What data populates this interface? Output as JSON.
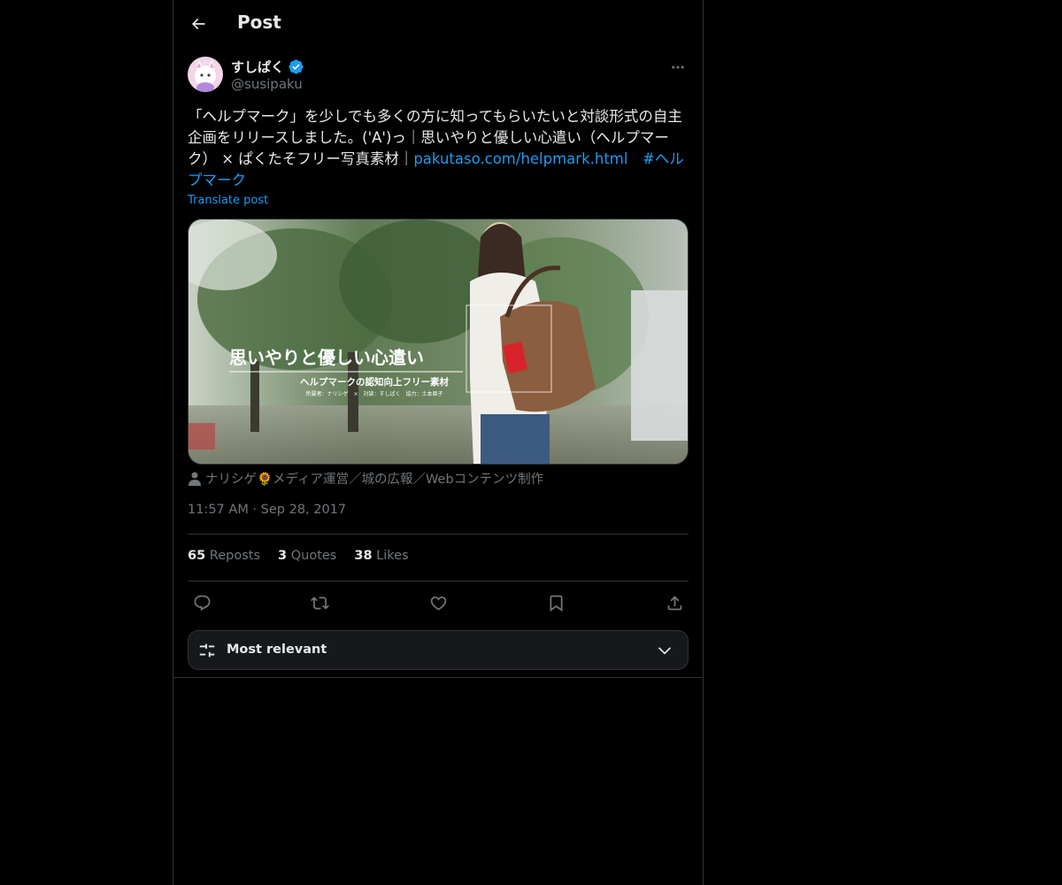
{
  "header": {
    "title": "Post"
  },
  "author": {
    "display_name": "すしぱく",
    "handle": "@susipaku",
    "verified": true
  },
  "tweet": {
    "text_before": "「ヘルプマーク」を少しでも多くの方に知ってもらいたいと対談形式の自主企画をリリースしました。('A')っ｜思いやりと優しい心遣い（ヘルプマーク） × ぱくたそフリー写真素材｜",
    "link": "pakutaso.com/helpmark.html",
    "hashtag": "#ヘルプマーク",
    "translate": "Translate post"
  },
  "media": {
    "title": "思いやりと優しい心遣い",
    "subtitle": "ヘルプマークの認知向上フリー素材",
    "credits": "所属者：ナリシゲ　×　対談：すしぱく　協力：土本亜子"
  },
  "attribution": "ナリシゲ🌻メディア運営／城の広報／Webコンテンツ制作",
  "timestamp": "11:57 AM · Sep 28, 2017",
  "stats": {
    "reposts_count": "65",
    "reposts_label": "Reposts",
    "quotes_count": "3",
    "quotes_label": "Quotes",
    "likes_count": "38",
    "likes_label": "Likes"
  },
  "sort": {
    "label": "Most relevant"
  },
  "colors": {
    "accent": "#1d9bf0",
    "text": "#e7e9ea",
    "muted": "#71767b",
    "border": "#2f3336",
    "background": "#000000"
  },
  "icons": [
    "back-arrow-icon",
    "verified-badge-icon",
    "more-icon",
    "person-icon",
    "reply-icon",
    "repost-icon",
    "like-icon",
    "bookmark-icon",
    "share-icon",
    "sliders-icon",
    "chevron-down-icon"
  ]
}
